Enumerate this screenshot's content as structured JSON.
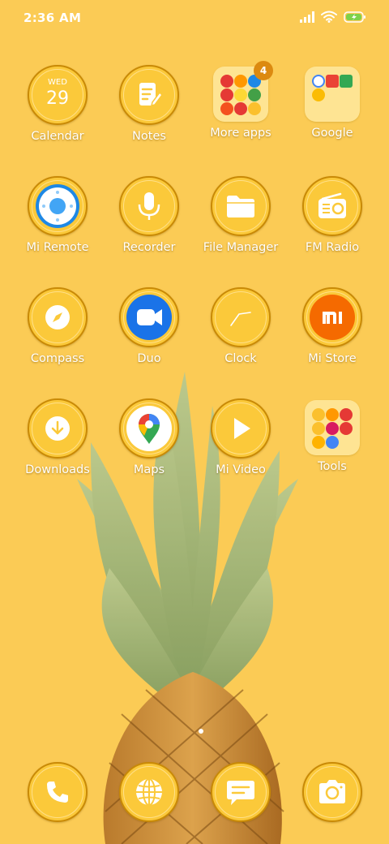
{
  "status_bar": {
    "time": "2:36 AM",
    "icons": [
      "signal-icon",
      "wifi-icon",
      "battery-charging-icon"
    ]
  },
  "apps": [
    {
      "label": "Calendar",
      "icon": "calendar-icon",
      "day": "WED",
      "date": "29"
    },
    {
      "label": "Notes",
      "icon": "notes-icon"
    },
    {
      "label": "More apps",
      "icon": "folder-icon",
      "badge": "4"
    },
    {
      "label": "Google",
      "icon": "folder-icon"
    },
    {
      "label": "Mi Remote",
      "icon": "remote-icon"
    },
    {
      "label": "Recorder",
      "icon": "microphone-icon"
    },
    {
      "label": "File Manager",
      "icon": "folder-file-icon"
    },
    {
      "label": "FM Radio",
      "icon": "radio-icon"
    },
    {
      "label": "Compass",
      "icon": "compass-icon"
    },
    {
      "label": "Duo",
      "icon": "duo-video-icon"
    },
    {
      "label": "Clock",
      "icon": "clock-icon"
    },
    {
      "label": "Mi Store",
      "icon": "mi-logo-icon",
      "logo_text": "mi"
    },
    {
      "label": "Downloads",
      "icon": "download-icon"
    },
    {
      "label": "Maps",
      "icon": "maps-pin-icon"
    },
    {
      "label": "Mi Video",
      "icon": "play-icon"
    },
    {
      "label": "Tools",
      "icon": "folder-icon"
    }
  ],
  "dock": [
    {
      "icon": "phone-icon"
    },
    {
      "icon": "browser-globe-icon"
    },
    {
      "icon": "messages-icon"
    },
    {
      "icon": "camera-icon"
    }
  ],
  "pages": {
    "current": 1,
    "count": 1
  },
  "colors": {
    "background": "#fbcb55",
    "icon_fill": "#fbc93a",
    "icon_ring": "#c98a06",
    "badge": "#dc8a10"
  }
}
